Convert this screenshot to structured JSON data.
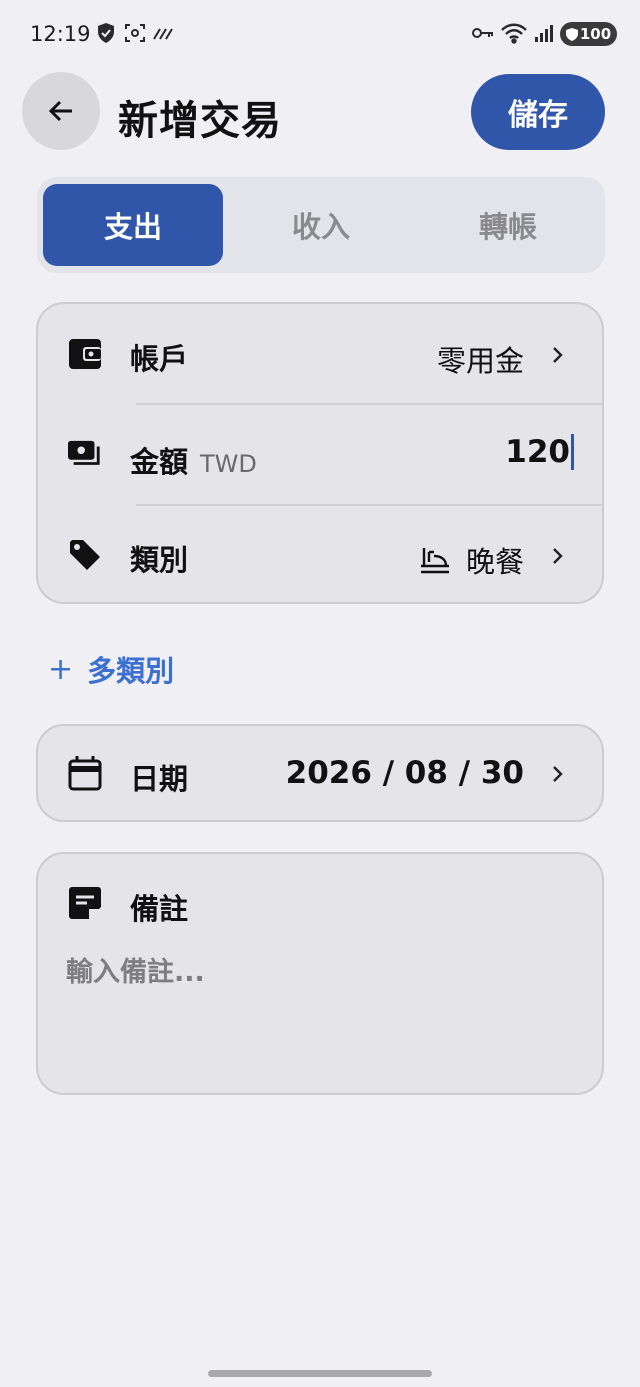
{
  "status_bar": {
    "time": "12:19",
    "battery": "100"
  },
  "header": {
    "title": "新增交易",
    "save_label": "儲存"
  },
  "tabs": [
    {
      "label": "支出",
      "active": true
    },
    {
      "label": "收入",
      "active": false
    },
    {
      "label": "轉帳",
      "active": false
    }
  ],
  "form": {
    "account": {
      "label": "帳戶",
      "value": "零用金"
    },
    "amount": {
      "label": "金額",
      "currency": "TWD",
      "value": "120"
    },
    "category": {
      "label": "類別",
      "value": "晚餐"
    }
  },
  "multi_category": {
    "label": "多類別"
  },
  "date": {
    "label": "日期",
    "value": "2026 / 08 / 30"
  },
  "note": {
    "label": "備註",
    "placeholder": "輸入備註..."
  },
  "colors": {
    "accent": "#2f56a8",
    "link": "#3b6fd0"
  }
}
